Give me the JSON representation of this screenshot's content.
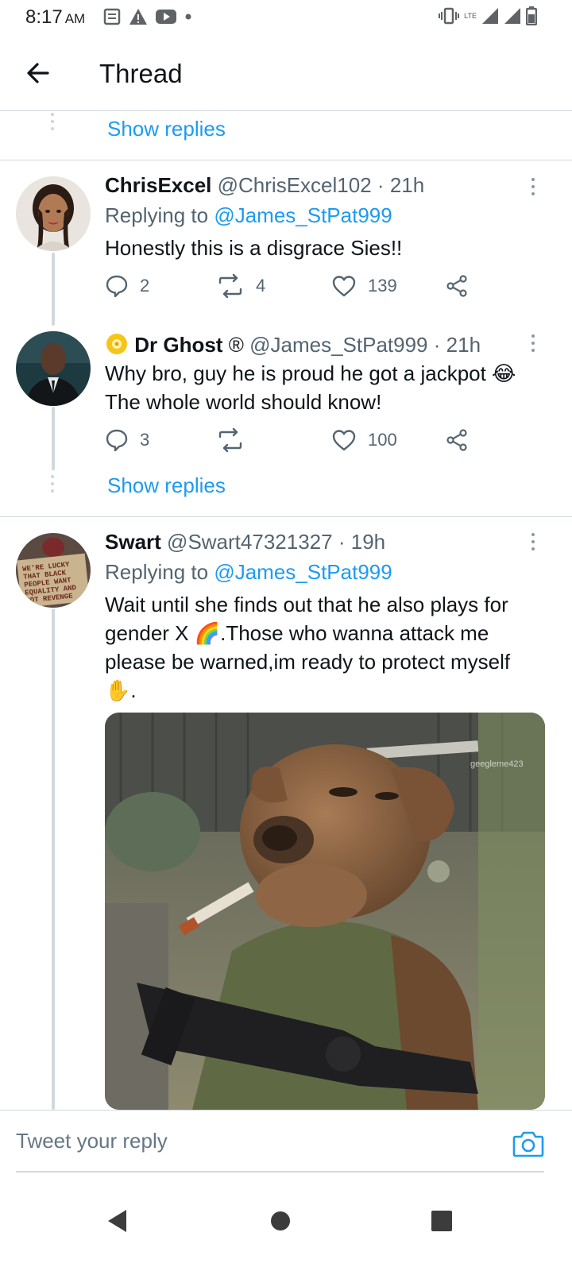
{
  "status_bar": {
    "time": "8:17",
    "ampm": "AM",
    "network": "LTE"
  },
  "header": {
    "title": "Thread"
  },
  "show_replies_label": "Show replies",
  "tweets": [
    {
      "name": "ChrisExcel",
      "handle": "@ChrisExcel102",
      "sep": "·",
      "time": "21h",
      "replying_prefix": "Replying to",
      "replying_handle": "@James_StPat999",
      "text": "Honestly this is a disgrace Sies!!",
      "replies": "2",
      "retweets": "4",
      "likes": "139"
    },
    {
      "name": "Dr Ghost",
      "name_suffix": "®",
      "handle": "@James_StPat999",
      "sep": "·",
      "time": "21h",
      "text_line1": "Why bro, guy he is proud he got a jackpot 😂",
      "text_line2": "The whole world should know!",
      "replies": "3",
      "retweets": "",
      "likes": "100"
    },
    {
      "name": "Swart",
      "handle": "@Swart47321327",
      "sep": "·",
      "time": "19h",
      "replying_prefix": "Replying to",
      "replying_handle": "@James_StPat999",
      "text": "Wait until she finds out that he also plays for gender X 🌈.Those who wanna attack me please be warned,im ready to protect myself ✋.",
      "avatar_sign_text": "WE'RE LUCKY THAT BLACK PEOPLE WANT EQUALITY AND NOT REVENGE",
      "media_watermark": "geegleme423"
    }
  ],
  "reply_box": {
    "placeholder": "Tweet your reply"
  },
  "colors": {
    "accent": "#1d9bf0",
    "secondary_text": "#536471",
    "divider": "#cfd9de"
  },
  "icons": [
    "arrow-left-icon",
    "reply-icon",
    "retweet-icon",
    "heart-icon",
    "share-icon",
    "more-vertical-icon",
    "camera-icon",
    "back-triangle-icon",
    "home-circle-icon",
    "recents-square-icon"
  ]
}
